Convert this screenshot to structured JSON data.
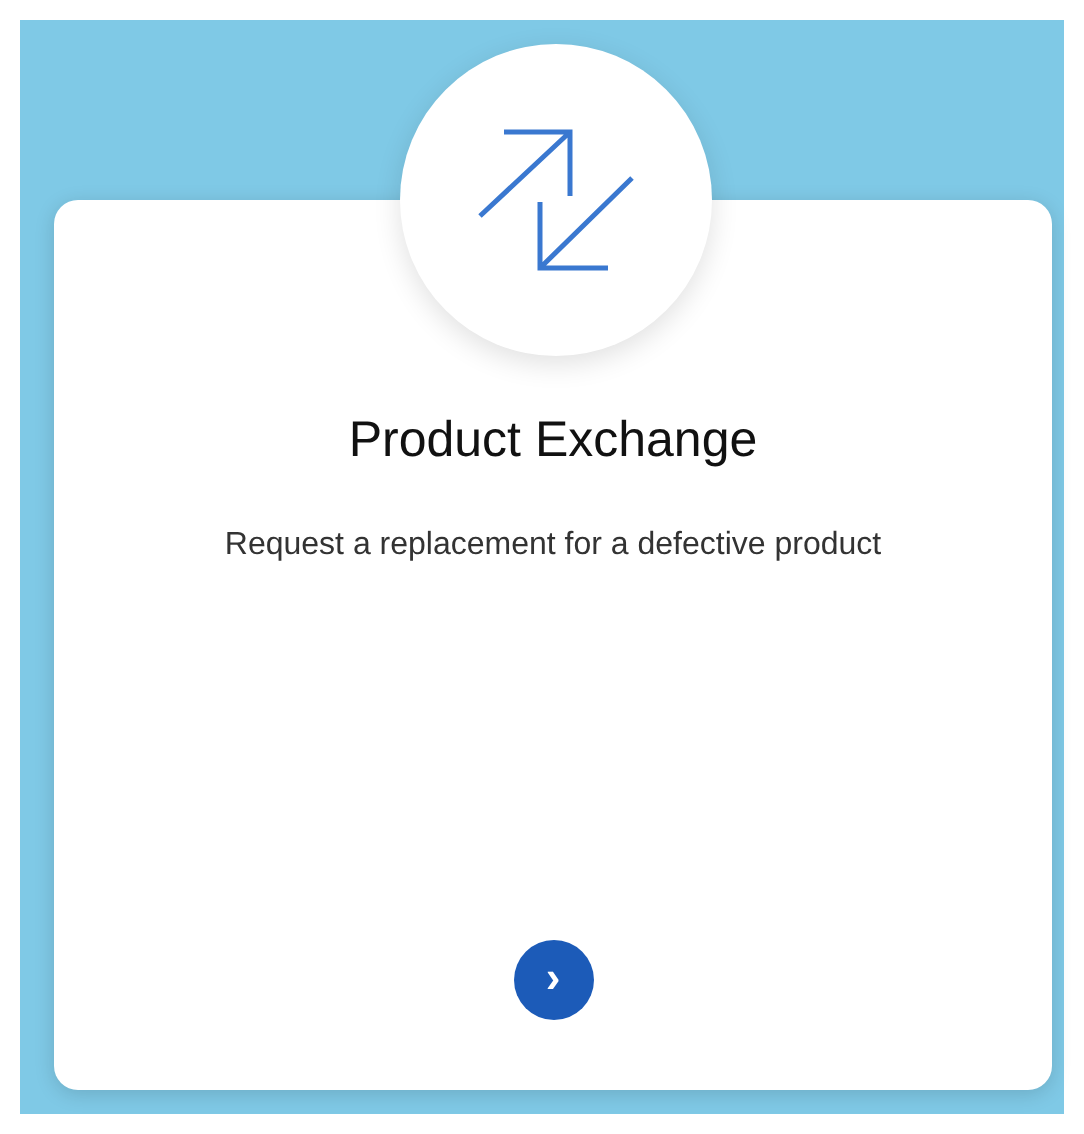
{
  "card": {
    "title": "Product Exchange",
    "description": "Request a replacement for a defective product",
    "action": {
      "glyph": "›"
    }
  }
}
